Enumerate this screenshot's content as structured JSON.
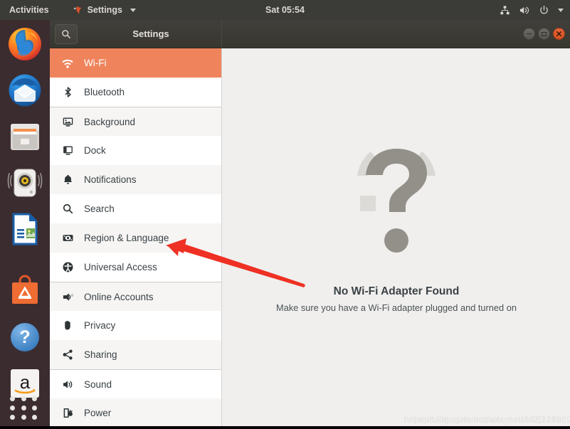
{
  "topbar": {
    "activities": "Activities",
    "app_menu": "Settings",
    "clock": "Sat 05:54",
    "tray": [
      {
        "name": "network-icon"
      },
      {
        "name": "volume-icon"
      },
      {
        "name": "power-icon"
      },
      {
        "name": "chevron-down-icon"
      }
    ]
  },
  "dock": {
    "items": [
      {
        "name": "firefox",
        "label": "Firefox"
      },
      {
        "name": "thunderbird",
        "label": "Thunderbird"
      },
      {
        "name": "files",
        "label": "Files"
      },
      {
        "name": "rhythmbox",
        "label": "Rhythmbox"
      },
      {
        "name": "libreoffice-writer",
        "label": "LibreOffice Writer"
      },
      {
        "name": "ubuntu-software",
        "label": "Ubuntu Software"
      },
      {
        "name": "help",
        "label": "Help"
      },
      {
        "name": "amazon",
        "label": "Amazon"
      }
    ],
    "show_apps_label": "Show Applications"
  },
  "window": {
    "title": "Settings",
    "search_icon": "search-icon",
    "controls": {
      "minimize": "minimize-button",
      "maximize": "maximize-button",
      "close": "close-button"
    }
  },
  "sidebar": {
    "items": [
      {
        "label": "Wi-Fi",
        "icon": "wifi-icon",
        "selected": true,
        "alt": false,
        "sep": false
      },
      {
        "label": "Bluetooth",
        "icon": "bluetooth-icon",
        "selected": false,
        "alt": false,
        "sep": false
      },
      {
        "label": "Background",
        "icon": "background-icon",
        "selected": false,
        "alt": true,
        "sep": true
      },
      {
        "label": "Dock",
        "icon": "dock-icon",
        "selected": false,
        "alt": false,
        "sep": false
      },
      {
        "label": "Notifications",
        "icon": "notifications-icon",
        "selected": false,
        "alt": true,
        "sep": false
      },
      {
        "label": "Search",
        "icon": "search-icon",
        "selected": false,
        "alt": false,
        "sep": false
      },
      {
        "label": "Region & Language",
        "icon": "region-language-icon",
        "selected": false,
        "alt": true,
        "sep": false
      },
      {
        "label": "Universal Access",
        "icon": "universal-access-icon",
        "selected": false,
        "alt": false,
        "sep": false
      },
      {
        "label": "Online Accounts",
        "icon": "online-accounts-icon",
        "selected": false,
        "alt": true,
        "sep": true
      },
      {
        "label": "Privacy",
        "icon": "privacy-icon",
        "selected": false,
        "alt": false,
        "sep": false
      },
      {
        "label": "Sharing",
        "icon": "sharing-icon",
        "selected": false,
        "alt": true,
        "sep": false
      },
      {
        "label": "Sound",
        "icon": "sound-icon",
        "selected": false,
        "alt": false,
        "sep": true
      },
      {
        "label": "Power",
        "icon": "power-icon",
        "selected": false,
        "alt": true,
        "sep": false
      }
    ]
  },
  "content": {
    "icon": "question-mark-icon",
    "title": "No Wi-Fi Adapter Found",
    "subtitle": "Make sure you have a Wi-Fi adapter plugged and turned on"
  },
  "watermark": {
    "text_a": "https://blog.csdn.net/wei_net/462|1269",
    "text_b": "https://blog.csdn.net/wei.net/46214269"
  },
  "annotation": {
    "arrow_color": "#ee3124",
    "target": "Region & Language"
  },
  "colors": {
    "accent": "#ef845c",
    "topbar": "#3b3b37",
    "dock": "#3b2c30",
    "headerbar": "#3c3b37",
    "panel": "#f0efee",
    "close_button": "#e8653a"
  }
}
